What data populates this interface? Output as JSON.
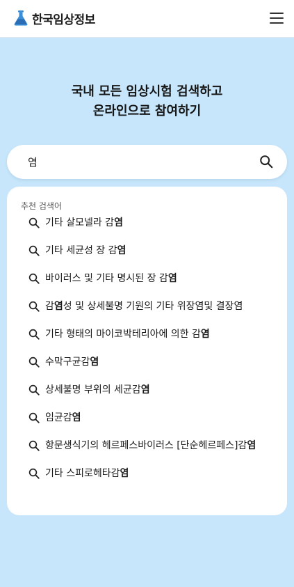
{
  "header": {
    "logo_text": "한국임상정보",
    "logo_icon": "flask-icon",
    "menu_icon": "hamburger-menu-icon"
  },
  "hero": {
    "line1": "국내 모든 임상시험 검색하고",
    "line2": "온라인으로 참여하기"
  },
  "search": {
    "value": "염",
    "icon": "search-icon"
  },
  "suggestions": {
    "title": "추천 검색어",
    "items": [
      {
        "before": "기타 살모넬라 감",
        "bold": "염",
        "after": ""
      },
      {
        "before": "기타 세균성 장 감",
        "bold": "염",
        "after": ""
      },
      {
        "before": "바이러스 및 기타 명시된 장 감",
        "bold": "염",
        "after": ""
      },
      {
        "before": "감",
        "bold": "염",
        "after": "성 및 상세불명 기원의 기타 위장염및 결장염"
      },
      {
        "before": "기타 형태의 마이코박테리아에 의한 감",
        "bold": "염",
        "after": ""
      },
      {
        "before": "수막구균감",
        "bold": "염",
        "after": ""
      },
      {
        "before": "상세불명 부위의 세균감",
        "bold": "염",
        "after": ""
      },
      {
        "before": "임균감",
        "bold": "염",
        "after": ""
      },
      {
        "before": "항문생식기의 헤르페스바이러스 [단순헤르페스]감",
        "bold": "염",
        "after": ""
      },
      {
        "before": "기타 스피로헤타감",
        "bold": "염",
        "after": ""
      }
    ]
  },
  "colors": {
    "background": "#c7e6fb",
    "logo_accent": "#3a8fd8"
  }
}
